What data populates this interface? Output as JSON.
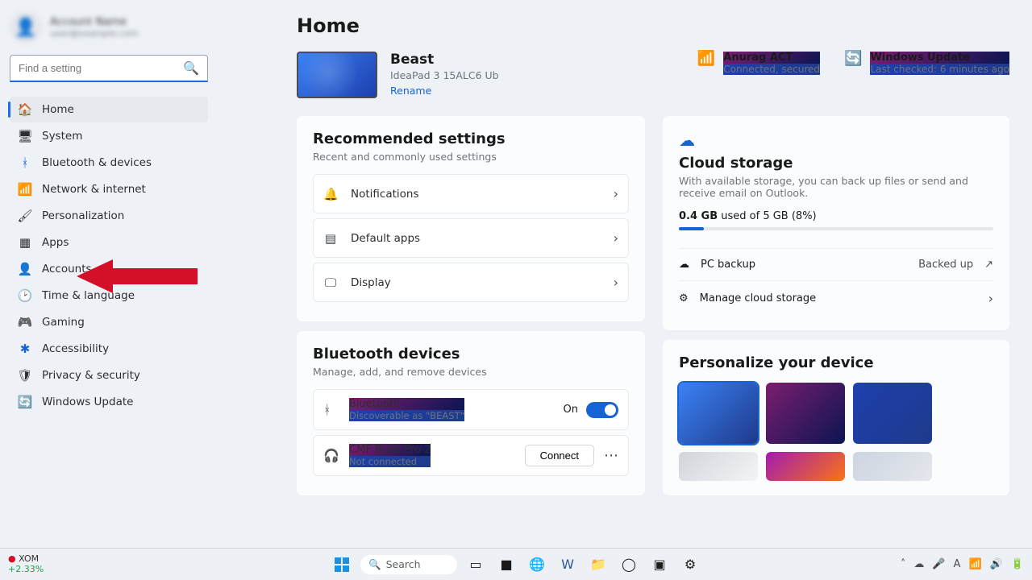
{
  "page": {
    "title": "Home"
  },
  "user": {
    "name": "Account Name",
    "email": "user@example.com"
  },
  "search": {
    "placeholder": "Find a setting"
  },
  "nav": {
    "items": [
      {
        "label": "Home",
        "icon": "🏠"
      },
      {
        "label": "System",
        "icon": "🖥"
      },
      {
        "label": "Bluetooth & devices",
        "icon": "ᚼ"
      },
      {
        "label": "Network & internet",
        "icon": "📶"
      },
      {
        "label": "Personalization",
        "icon": "🖌"
      },
      {
        "label": "Apps",
        "icon": "▦"
      },
      {
        "label": "Accounts",
        "icon": "👤"
      },
      {
        "label": "Time & language",
        "icon": "🕑"
      },
      {
        "label": "Gaming",
        "icon": "🎮"
      },
      {
        "label": "Accessibility",
        "icon": "✱"
      },
      {
        "label": "Privacy & security",
        "icon": "🛡"
      },
      {
        "label": "Windows Update",
        "icon": "🔄"
      }
    ]
  },
  "device": {
    "name": "Beast",
    "model": "IdeaPad 3 15ALC6 Ub",
    "rename": "Rename"
  },
  "status": {
    "wifi": {
      "title": "Anurag ACT",
      "sub": "Connected, secured"
    },
    "update": {
      "title": "Windows Update",
      "sub": "Last checked: 6 minutes ago"
    }
  },
  "recommended": {
    "title": "Recommended settings",
    "sub": "Recent and commonly used settings",
    "items": [
      {
        "label": "Notifications"
      },
      {
        "label": "Default apps"
      },
      {
        "label": "Display"
      }
    ]
  },
  "cloud": {
    "title": "Cloud storage",
    "desc": "With available storage, you can back up files or send and receive email on Outlook.",
    "usage_bold": "0.4 GB",
    "usage_rest": " used of 5 GB (8%)",
    "percent": 8,
    "backup_label": "PC backup",
    "backup_status": "Backed up",
    "manage_label": "Manage cloud storage"
  },
  "bluetooth": {
    "title": "Bluetooth devices",
    "sub": "Manage, add, and remove devices",
    "toggle_label": "Bluetooth",
    "toggle_sub": "Discoverable as \"BEAST\"",
    "toggle_state": "On",
    "device1_name": "CMF Buds Pro 2",
    "device1_sub": "Not connected",
    "connect_label": "Connect"
  },
  "personalize": {
    "title": "Personalize your device"
  },
  "taskbar": {
    "stock_code": "XOM",
    "stock_pct": "+2.33%",
    "search": "Search"
  }
}
